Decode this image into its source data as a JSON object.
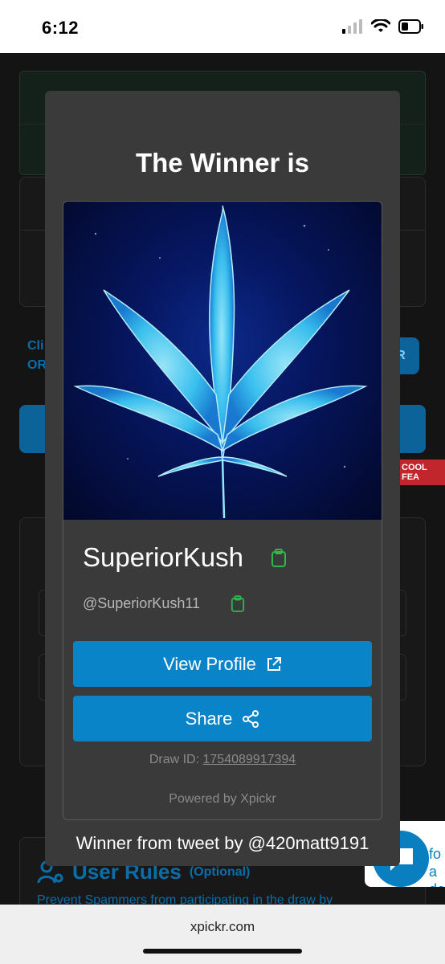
{
  "status_bar": {
    "time": "6:12"
  },
  "background": {
    "left_text": [
      "Cli",
      "OR"
    ],
    "right_btn_text": "R",
    "red_tag": "COOL FEA",
    "user_rules_title": "User Rules",
    "user_rules_optional": "(Optional)",
    "user_rules_sub": "Prevent Spammers from participating in the draw by"
  },
  "help_widget": {
    "text": [
      "fo",
      "a do"
    ]
  },
  "modal": {
    "title": "The Winner is",
    "winner_name": "SuperiorKush",
    "winner_handle": "@SuperiorKush11",
    "view_profile_label": "View Profile",
    "share_label": "Share",
    "draw_id_label": "Draw ID:",
    "draw_id_value": "1754089917394",
    "powered_by": "Powered by Xpickr",
    "tweet_by": "Winner from tweet by @420matt9191"
  },
  "browser": {
    "url": "xpickr.com"
  },
  "colors": {
    "accent": "#0a84c9",
    "copy_icon": "#2db84b",
    "modal_bg": "#3a3a3a"
  }
}
